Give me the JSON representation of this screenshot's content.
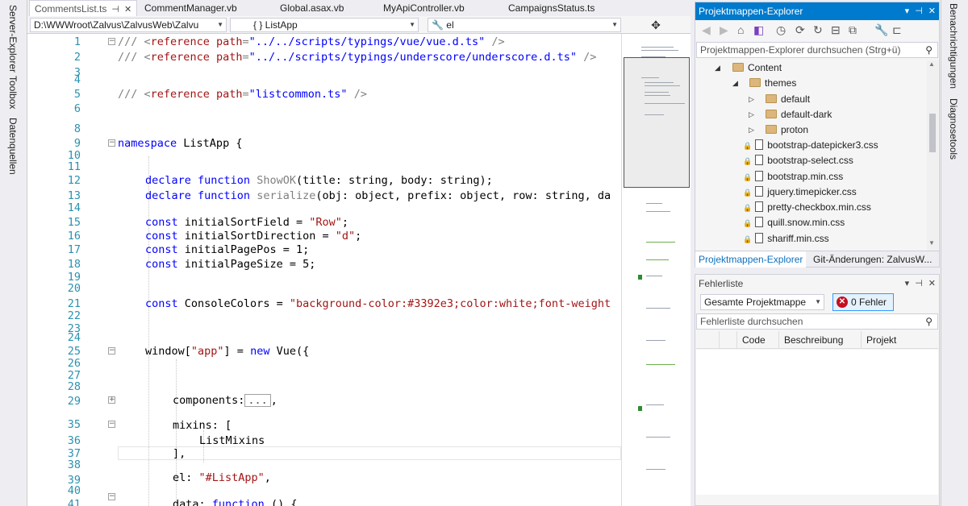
{
  "left_strip": {
    "items": [
      "Server-Explorer",
      "Toolbox",
      "Datenquellen"
    ]
  },
  "right_strip": {
    "items": [
      "Benachrichtigungen",
      "Diagnosetools"
    ]
  },
  "tabs": [
    {
      "label": "CommentsList.ts",
      "active": true
    },
    {
      "label": "CommentManager.vb"
    },
    {
      "label": "Global.asax.vb"
    },
    {
      "label": "MyApiController.vb"
    },
    {
      "label": "CampaignsStatus.ts"
    }
  ],
  "tab_icons": {
    "pin": "⊣",
    "close": "✕"
  },
  "navbar": {
    "project_combo": "D:\\WWWroot\\Zalvus\\ZalvusWeb\\Zalvu",
    "scope_combo": "{ } ListApp",
    "member_combo": "el"
  },
  "editor": {
    "line_numbers": [
      "1",
      "2",
      "3",
      "4",
      "5",
      "6",
      "7",
      "8",
      "9",
      "10",
      "11",
      "12",
      "13",
      "14",
      "15",
      "16",
      "17",
      "18",
      "19",
      "20",
      "21",
      "22",
      "23",
      "24",
      "25",
      "26",
      "27",
      "28",
      "29",
      "35",
      "36",
      "37",
      "38",
      "39",
      "40",
      "41"
    ],
    "ref_path_1": "\"../../scripts/typings/vue/vue.d.ts\"",
    "ref_path_2": "\"../../scripts/typings/underscore/underscore.d.ts\"",
    "ref_path_3": "\"listcommon.ts\"",
    "namespace_name": "ListApp",
    "fn1_name": "ShowOK",
    "fn1_params": "(title: string, body: string);",
    "fn2_name": "serialize",
    "fn2_params": "(obj: object, prefix: object, row: string, da",
    "const1": "initialSortField = ",
    "const1_val": "\"Row\"",
    "const2": "initialSortDirection = ",
    "const2_val": "\"d\"",
    "const3": "initialPagePos = 1;",
    "const4": "initialPageSize = 5;",
    "const5": "ConsoleColors = ",
    "const5_val": "\"background-color:#3392e3;color:white;font-weight",
    "window_key": "\"app\"",
    "vue_call": "Vue({",
    "components": "components:",
    "collapsed_marker": "...",
    "mixins": "mixins: [",
    "mixin_item": "ListMixins",
    "mixins_end": "],",
    "el_key": "el: ",
    "el_val": "\"#ListApp\"",
    "data_key": "data: ",
    "data_rest": " () {"
  },
  "solution_explorer": {
    "title": "Projektmappen-Explorer",
    "search_placeholder": "Projektmappen-Explorer durchsuchen (Strg+ü)",
    "tree": [
      {
        "label": "Content",
        "type": "folder",
        "expanded": true,
        "depth": 0
      },
      {
        "label": "themes",
        "type": "folder",
        "expanded": true,
        "depth": 1
      },
      {
        "label": "default",
        "type": "folder",
        "expanded": false,
        "depth": 2
      },
      {
        "label": "default-dark",
        "type": "folder",
        "expanded": false,
        "depth": 2
      },
      {
        "label": "proton",
        "type": "folder",
        "expanded": false,
        "depth": 2
      },
      {
        "label": "bootstrap-datepicker3.css",
        "type": "file",
        "depth": 1
      },
      {
        "label": "bootstrap-select.css",
        "type": "file",
        "depth": 1
      },
      {
        "label": "bootstrap.min.css",
        "type": "file",
        "depth": 1
      },
      {
        "label": "jquery.timepicker.css",
        "type": "file",
        "depth": 1
      },
      {
        "label": "pretty-checkbox.min.css",
        "type": "file",
        "depth": 1
      },
      {
        "label": "quill.snow.min.css",
        "type": "file",
        "depth": 1
      },
      {
        "label": "shariff.min.css",
        "type": "file",
        "depth": 1
      }
    ],
    "bottom_tabs": [
      "Projektmappen-Explorer",
      "Git-Änderungen: ZalvusW..."
    ]
  },
  "error_list": {
    "title": "Fehlerliste",
    "scope": "Gesamte Projektmappe",
    "errors_label": "0 Fehler",
    "search_placeholder": "Fehlerliste durchsuchen",
    "columns": [
      "Code",
      "Beschreibung",
      "Projekt"
    ]
  },
  "colors": {
    "accent": "#007acc",
    "keyword": "#0000ff",
    "string": "#a31515",
    "line_number": "#2b91af"
  }
}
